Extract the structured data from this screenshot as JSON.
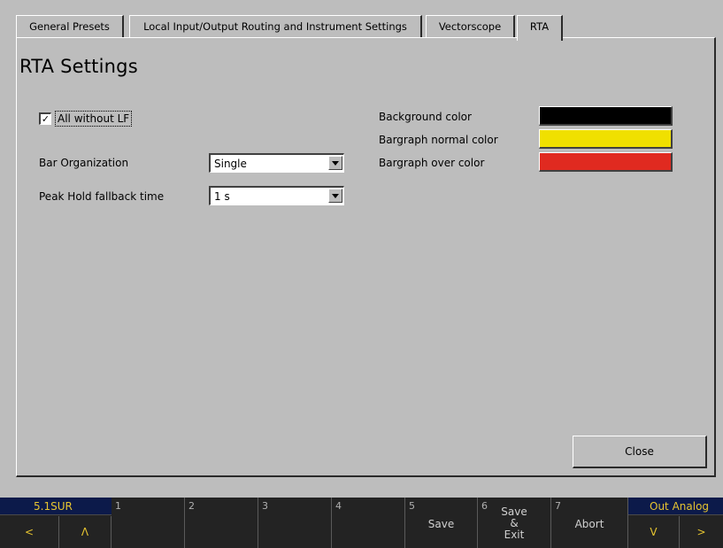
{
  "tabs": [
    {
      "label": "General Presets",
      "active": false
    },
    {
      "label": "Local Input/Output Routing and Instrument Settings",
      "active": false
    },
    {
      "label": "Vectorscope",
      "active": false
    },
    {
      "label": "RTA",
      "active": true
    }
  ],
  "page": {
    "title": "RTA Settings"
  },
  "all_without_lf": {
    "label": "All without LF",
    "checked": true,
    "mark": "✓"
  },
  "bar_organization": {
    "label": "Bar Organization",
    "value": "Single"
  },
  "peak_hold": {
    "label": "Peak Hold fallback time",
    "value": "1 s"
  },
  "colors": [
    {
      "label": "Background color",
      "value": "#000000"
    },
    {
      "label": "Bargraph normal color",
      "value": "#f0e000"
    },
    {
      "label": "Bargraph over color",
      "value": "#e02a20"
    }
  ],
  "close_label": "Close",
  "softkeys": {
    "mode_left": "5.1SUR",
    "mode_right": "Out Analog",
    "nav_left": "<",
    "nav_up": "Λ",
    "nav_down": "V",
    "nav_right": ">",
    "keys": [
      {
        "num": "1",
        "label": ""
      },
      {
        "num": "2",
        "label": ""
      },
      {
        "num": "3",
        "label": ""
      },
      {
        "num": "4",
        "label": ""
      },
      {
        "num": "5",
        "label": "Save"
      },
      {
        "num": "6",
        "label": "Save\n&\nExit"
      },
      {
        "num": "7",
        "label": "Abort"
      }
    ]
  }
}
